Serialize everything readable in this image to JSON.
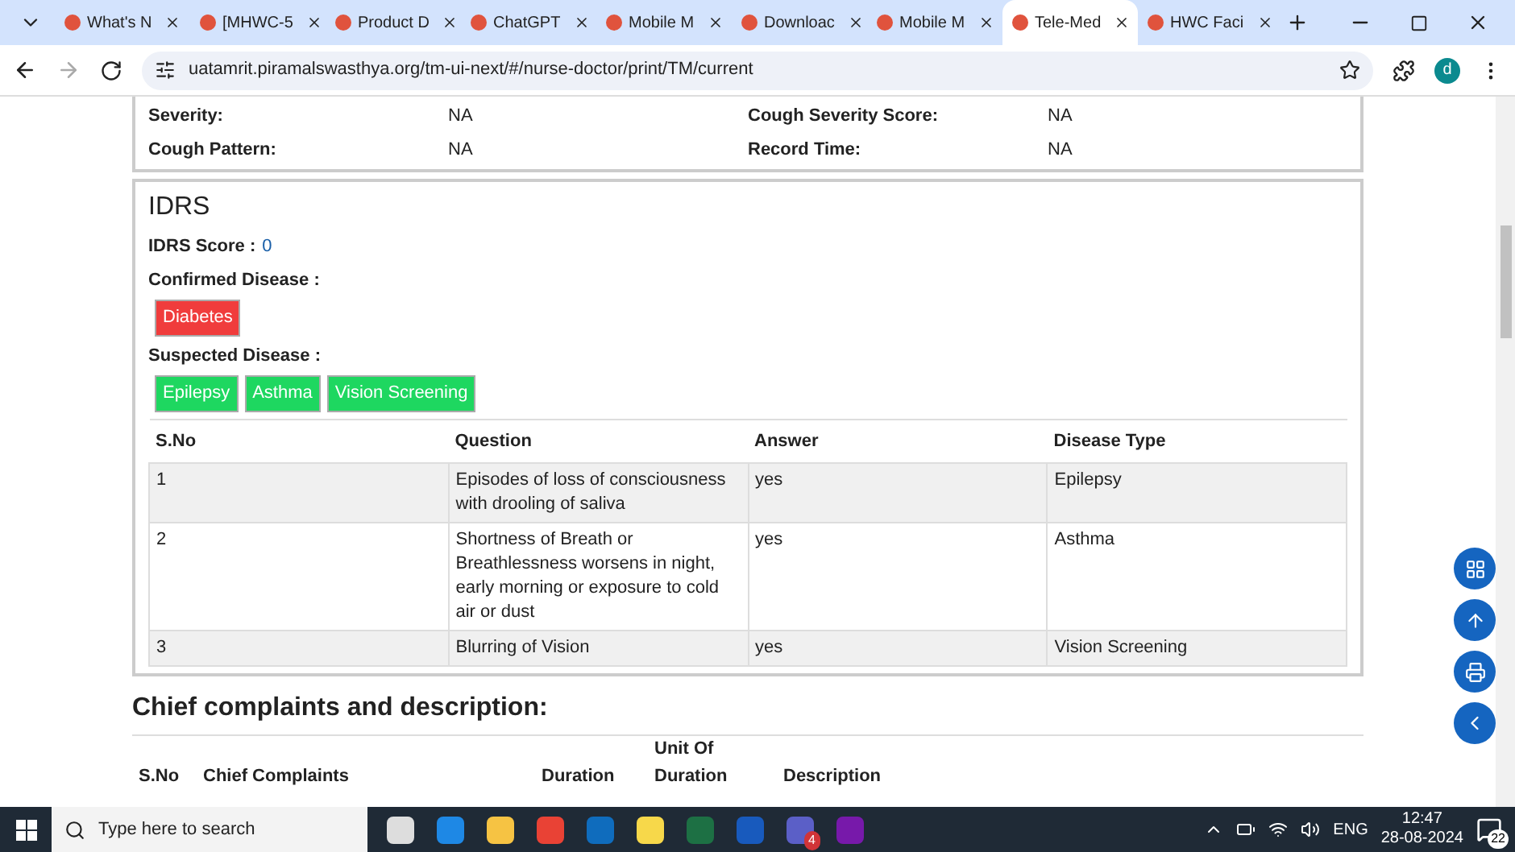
{
  "browser": {
    "tabs": [
      {
        "title": "What's N",
        "selected": false
      },
      {
        "title": "[MHWC-5",
        "selected": false
      },
      {
        "title": "Product D",
        "selected": false
      },
      {
        "title": "ChatGPT",
        "selected": false
      },
      {
        "title": "Mobile M",
        "selected": false
      },
      {
        "title": "Downloac",
        "selected": false
      },
      {
        "title": "Mobile M",
        "selected": false
      },
      {
        "title": "Tele-Med",
        "selected": true
      },
      {
        "title": "HWC Faci",
        "selected": false
      }
    ],
    "url": "uatamrit.piramalswasthya.org/tm-ui-next/#/nurse-doctor/print/TM/current",
    "profile": "d"
  },
  "cough": {
    "fields": [
      {
        "label": "Severity:",
        "value": "NA"
      },
      {
        "label": "Cough Severity Score:",
        "value": "NA"
      },
      {
        "label": "Cough Pattern:",
        "value": "NA"
      },
      {
        "label": "Record Time:",
        "value": "NA"
      }
    ]
  },
  "idrs": {
    "title": "IDRS",
    "score_label": "IDRS Score :",
    "score": "0",
    "confirmed_label": "Confirmed Disease :",
    "confirmed": [
      {
        "name": "Diabetes",
        "color": "#f03c3c"
      }
    ],
    "suspected_label": "Suspected Disease :",
    "suspected": [
      {
        "name": "Epilepsy",
        "color": "#1ed760"
      },
      {
        "name": "Asthma",
        "color": "#1ed760"
      },
      {
        "name": "Vision Screening",
        "color": "#1ed760"
      }
    ],
    "table": {
      "columns": [
        "S.No",
        "Question",
        "Answer",
        "Disease Type"
      ],
      "rows": [
        [
          "1",
          "Episodes of loss of consciousness with drooling of saliva",
          "yes",
          "Epilepsy"
        ],
        [
          "2",
          "Shortness of Breath or Breathlessness worsens in night, early morning or exposure to cold air or dust",
          "yes",
          "Asthma"
        ],
        [
          "3",
          "Blurring of Vision",
          "yes",
          "Vision Screening"
        ]
      ]
    }
  },
  "chief_complaints": {
    "title": "Chief complaints and description:",
    "columns": [
      "S.No",
      "Chief Complaints",
      "Duration",
      "Unit Of Duration",
      "Description"
    ]
  },
  "taskbar": {
    "search_placeholder": "Type here to search",
    "teams_badge": "4",
    "language": "ENG",
    "time": "12:47",
    "date": "28-08-2024",
    "notifications": "22"
  }
}
